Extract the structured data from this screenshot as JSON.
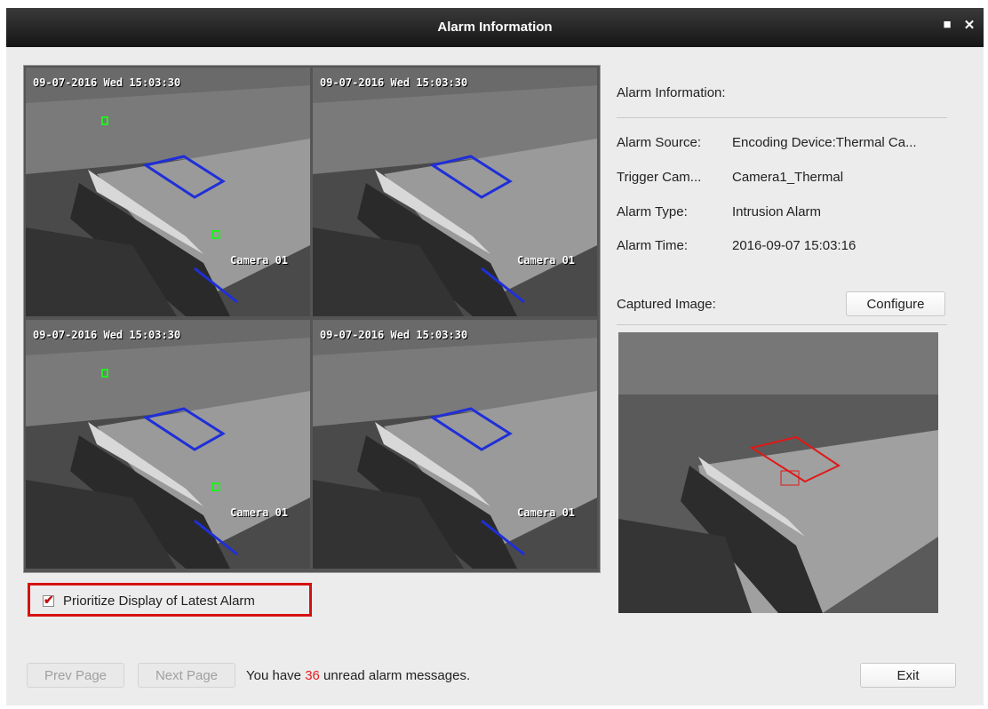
{
  "window": {
    "title": "Alarm Information",
    "maximize_glyph": "■",
    "close_glyph": "✕"
  },
  "live_views": [
    {
      "timestamp": "09-07-2016 Wed 15:03:30",
      "camera_osd": "Camera 01"
    },
    {
      "timestamp": "09-07-2016 Wed 15:03:30",
      "camera_osd": "Camera 01"
    },
    {
      "timestamp": "09-07-2016 Wed 15:03:30",
      "camera_osd": "Camera 01"
    },
    {
      "timestamp": "09-07-2016 Wed 15:03:30",
      "camera_osd": "Camera 01"
    }
  ],
  "prioritize": {
    "label": "Prioritize Display of Latest Alarm",
    "checked": true,
    "check_glyph": "✔"
  },
  "alarm_info": {
    "heading": "Alarm Information:",
    "rows": [
      {
        "label": "Alarm Source:",
        "value": "Encoding Device:Thermal Ca..."
      },
      {
        "label": "Trigger Cam...",
        "value": "Camera1_Thermal"
      },
      {
        "label": "Alarm Type:",
        "value": "Intrusion Alarm"
      },
      {
        "label": "Alarm Time:",
        "value": "2016-09-07 15:03:16"
      }
    ]
  },
  "captured": {
    "label": "Captured Image:",
    "configure_label": "Configure"
  },
  "footer": {
    "prev_label": "Prev Page",
    "next_label": "Next Page",
    "message_prefix": "You have ",
    "unread_count": "36",
    "message_suffix": " unread alarm messages.",
    "exit_label": "Exit"
  },
  "colors": {
    "intrusion_region": "#1f2fd8",
    "line_crossing": "#1f2fd8",
    "target_box": "#22ee22",
    "capture_region": "#e01818",
    "highlight_border": "#d61111",
    "unread_count": "#e02020"
  }
}
